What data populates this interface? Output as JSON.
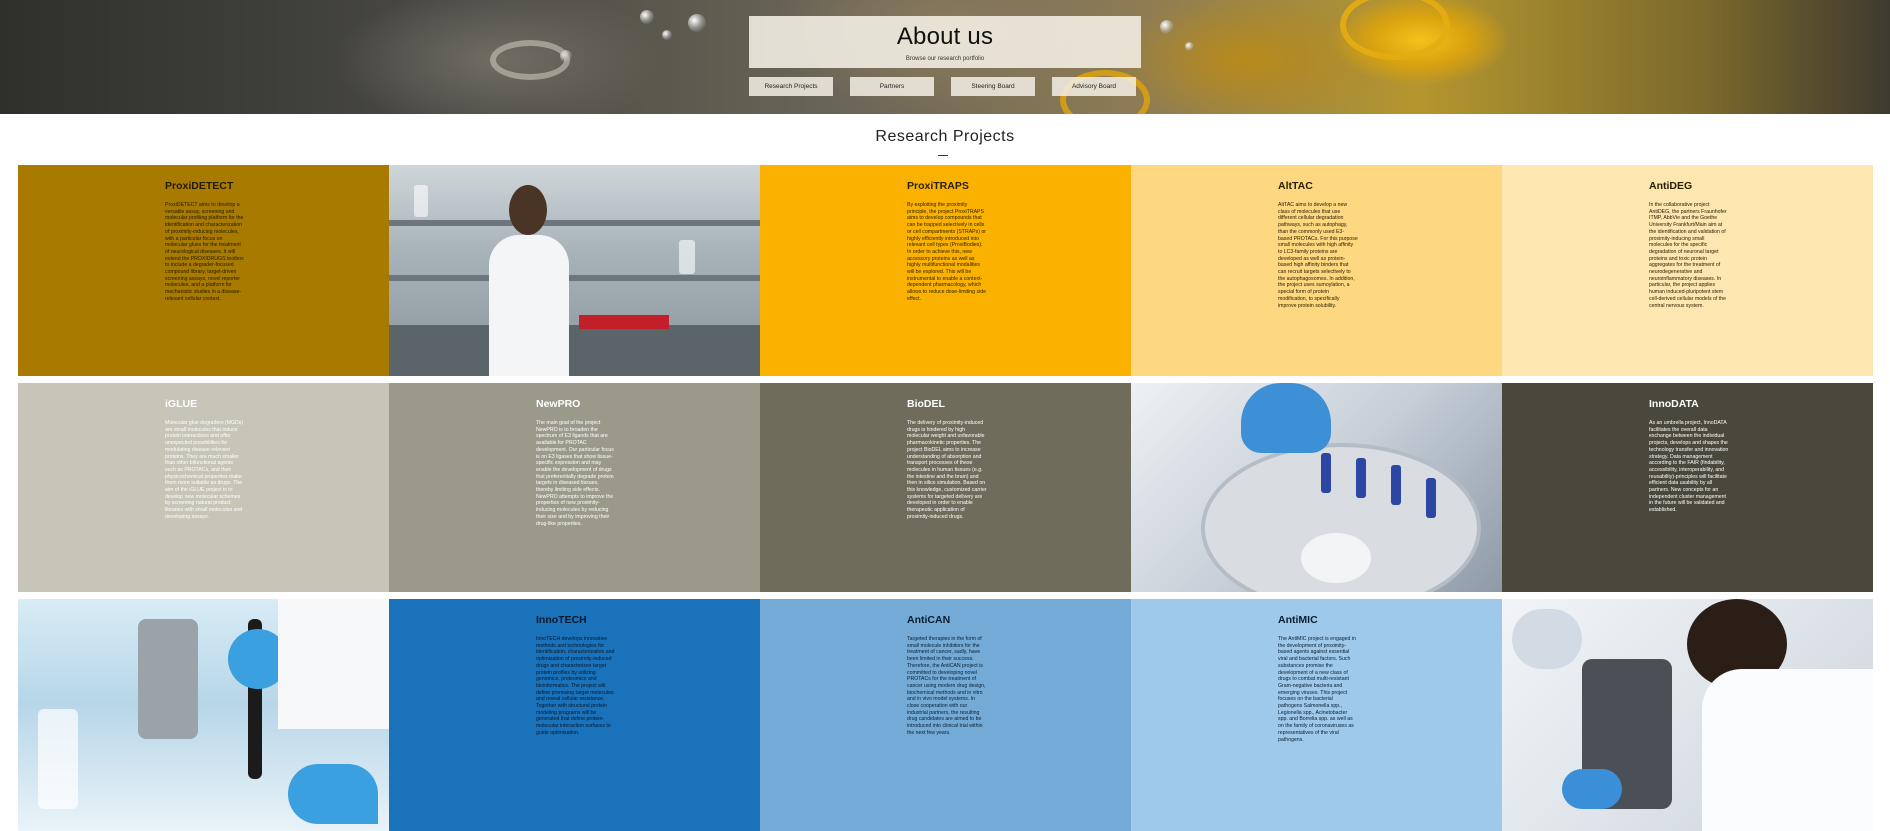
{
  "hero": {
    "title": "About us",
    "subtitle": "Browse our research portfolio",
    "tabs": [
      "Research Projects",
      "Partners",
      "Steering Board",
      "Advisory Board"
    ]
  },
  "section": {
    "title": "Research Projects"
  },
  "projects": [
    {
      "name": "ProxiDETECT",
      "text": "ProxiDETECT aims to develop a versatile assay, screening and molecular profiling platform for the identification and characterization of proximity-inducing molecules, with a particular focus on molecular glues for the treatment of neurological diseases. It will extend the PROXIDRUGS toolbox to include a degrader-focused compound library, target-driven screening assays, novel reporter molecules, and a platform for mechanistic studies in a disease-relevant cellular context."
    },
    {
      "name": "ProxiTRAPS",
      "text": "By exploiting the proximity principle, the project ProxiTRAPS aims to develop compounds that can be trapped selectively in cells or cell compartments (STRAPs) or highly efficiently introduced into relevant cell types (ProxiBodies). In order to achieve this, new accessory proteins as well as highly multifunctional modalities will be explored. This will be instrumental to enable a context-dependent pharmacology, which allows to reduce dose-limiting side effect."
    },
    {
      "name": "AltTAC",
      "text": "AltTAC aims to develop a new class of molecules that use different cellular degradation pathways, such as autophagy, than the commonly used E3-based PROTACs. For this purpose small molecules with high affinity to LC3-family proteins are developed as well as protein-based high affinity binders that can recruit targets selectively to the autophagosomes. In addition, the project uses sumoylation, a special form of protein modification, to specifically improve protein solubility."
    },
    {
      "name": "AntiDEG",
      "text": "In the collaborative project AntiDEG, the partners Fraunhofer ITMP, AbbVie and the Goethe University Frankfurt/Main aim at the identification and validation of proximity-inducing small molecules for the specific degradation of neuronal target proteins and toxic protein aggregates for the treatment of neurodegenerative and neuroinflammatory diseases. In particular, the project applies human induced-pluripotent stem cell-derived cellular models of the central nervous system."
    },
    {
      "name": "iGLUE",
      "text": "Molecular glue degraders (MGDs) are small molecules that induce protein interactions and offer unexpected possibilities for modulating disease-relevant proteins. They are much smaller than other bifunctional agents such as PROTACs, and their physicochemical properties make them more suitable as drugs. The aim of the iGLUE project is to develop new molecular schemes by screening natural product libraries with small molecules and developing assays."
    },
    {
      "name": "NewPRO",
      "text": "The main goal of the project NewPRO is to broaden the spectrum of E3 ligands that are available for PROTAC development. Our particular focus is on E3 ligases that show tissue-specific expression and may enable the development of drugs that preferentially degrade protein targets in diseased tissues, thereby limiting side effects. NewPRO attempts to improve the properties of new proximity-inducing molecules by reducing their size and by improving their drug-like properties."
    },
    {
      "name": "BioDEL",
      "text": "The delivery of proximity-induced drugs is hindered by high molecular weight and unfavorable pharmacokinetic properties. The project BioDEL aims to increase understanding of absorption and transport processes of these molecules in human tissues (e.g. the intestine and the brain) and then in silico simulation. Based on this knowledge, customized carrier systems for targeted delivery are developed in order to enable therapeutic application of proximity-induced drugs."
    },
    {
      "name": "InnoDATA",
      "text": "As an umbrella project, InnoDATA facilitates the overall data exchange between the individual projects, develops and shapes the technology transfer and innovation strategy. Data management according to the FAIR (findability, accessibility, interoperability, and reusability)-principles will facilitate efficient data usability by all partners. New concepts for an independent cluster management in the future will be validated and established."
    },
    {
      "name": "InnoTECH",
      "text": "InnoTECH develops innovative methods and technologies for identification, characterization and optimization of proximity-induced drugs and characterizes target protein profiles by utilizing genomics, proteomics and bioinformatics. The project will define promising target molecules and reveal cellular resistance. Together with structural protein modeling programs will be generated that define protein-molecular interaction surfaces to guide optimization."
    },
    {
      "name": "AntiCAN",
      "text": "Targeted therapies in the form of small molecule inhibitors for the treatment of cancer, sadly, have been limited in their success. Therefore, the AntiCAN project is committed to developing novel PROTACs for the treatment of cancer using modern drug design, biochemical methods and in vitro and in vivo model systems. In close cooperation with our industrial partners, the resulting drug candidates are aimed to be introduced into clinical trial within the next few years."
    },
    {
      "name": "AntiMIC",
      "text": "The AntiMIC project is engaged in the development of proximity-based agents against essential viral and bacterial factors. Such substances promise the development of a new class of drugs to combat multi-resistant Gram-negative bacteria and emerging viruses. This project focuses on the bacterial pathogens Salmonella spp., Legionella spp., Acinetobacter spp. and Borrelia spp. as well as on the family of coronaviruses as representatives of the viral pathogens."
    }
  ],
  "colors": {
    "proxidetect": "#a87a00",
    "proxitraps": "#fbb100",
    "alttac": "#fed880",
    "antideg": "#fde6b0",
    "iglue": "#c7c5b8",
    "newpro": "#9b9a8a",
    "biodel": "#6f6c5c",
    "innodata": "#4a483c",
    "innotech": "#1a72ba",
    "antican": "#73abd6",
    "antimic": "#9ec9ea"
  },
  "icons": {
    "lab-photo-1": "scientist-in-lab-photo",
    "lab-photo-2": "centrifuge-photo",
    "lab-photo-3": "pipette-microscope-photo",
    "lab-photo-4": "microscope-researcher-photo"
  }
}
